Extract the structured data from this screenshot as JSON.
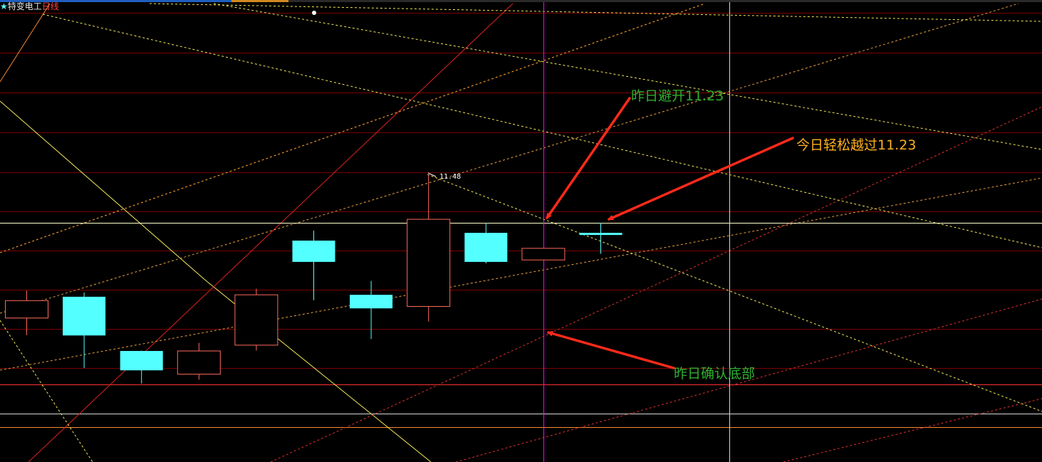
{
  "header": {
    "star": "★",
    "stock_name": "特变电工",
    "period": "日线"
  },
  "colors": {
    "background": "#000000",
    "up_candle": "#ff6a5c",
    "down_candle": "#54ffff",
    "gridline": "#7a0000",
    "annotation_green": "#2fb12f",
    "annotation_orange": "#ffb020",
    "arrow": "#ff2a1a",
    "crosshair_vertical": "#ff00ff",
    "crosshair_horizontal": "#ffffcc"
  },
  "chart_data": {
    "type": "candlestick",
    "y_scale": "linear",
    "y_range_visible": [
      10.5,
      11.75
    ],
    "candles": [
      {
        "open": 10.74,
        "close": 10.83,
        "high": 10.88,
        "low": 10.65,
        "direction": "up"
      },
      {
        "open": 10.85,
        "close": 10.65,
        "high": 10.87,
        "low": 10.48,
        "direction": "down"
      },
      {
        "open": 10.57,
        "close": 10.47,
        "high": 10.57,
        "low": 10.4,
        "direction": "down"
      },
      {
        "open": 10.45,
        "close": 10.57,
        "high": 10.61,
        "low": 10.42,
        "direction": "up"
      },
      {
        "open": 10.6,
        "close": 10.86,
        "high": 10.89,
        "low": 10.57,
        "direction": "up"
      },
      {
        "open": 11.14,
        "close": 11.03,
        "high": 11.19,
        "low": 10.83,
        "direction": "down"
      },
      {
        "open": 10.86,
        "close": 10.79,
        "high": 10.93,
        "low": 10.63,
        "direction": "down"
      },
      {
        "open": 10.8,
        "close": 11.25,
        "high": 11.48,
        "low": 10.72,
        "direction": "up"
      },
      {
        "open": 11.18,
        "close": 11.03,
        "high": 11.23,
        "low": 11.02,
        "direction": "down"
      },
      {
        "open": 11.04,
        "close": 11.1,
        "high": 11.1,
        "low": 11.04,
        "direction": "up"
      },
      {
        "open": 11.18,
        "close": 11.18,
        "high": 11.23,
        "low": 11.07,
        "direction": "down"
      }
    ],
    "high_marker_label": "11.48",
    "crosshair_price": 11.23,
    "annotations": [
      {
        "text": "昨日避开11.23",
        "color": "green"
      },
      {
        "text": "今日轻松越过11.23",
        "color": "orange"
      },
      {
        "text": "昨日确认底部",
        "color": "green"
      }
    ]
  }
}
